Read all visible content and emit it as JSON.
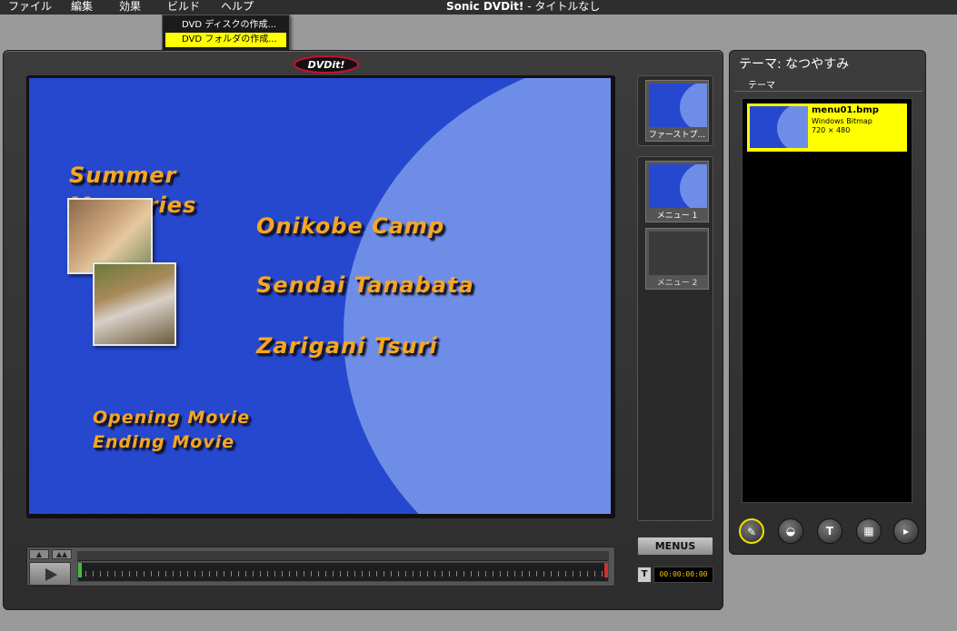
{
  "menubar": {
    "items": [
      "ファイル",
      "編集",
      "効果",
      "ビルド",
      "ヘルプ"
    ],
    "app_title": "Sonic DVDit!",
    "doc_title": " - タイトルなし"
  },
  "build_menu": {
    "items": [
      "DVD ディスクの作成...",
      "DVD フォルダの作成..."
    ],
    "highlighted_index": 1
  },
  "main": {
    "logo_text": "DVDit!",
    "menu_preview": {
      "title_line1": "Summer",
      "title_line2": "Memories",
      "link1": "Onikobe Camp",
      "link2": "Sendai Tanabata",
      "link3": "Zarigani Tsuri",
      "link4": "Opening Movie",
      "link5": "Ending Movie"
    },
    "thumbnails": {
      "first_play_label": "ファーストプ...",
      "menu1_label": "メニュー 1",
      "menu2_label": "メニュー 2"
    },
    "timeline": {
      "small_btn1": "▲",
      "small_btn2": "▲▲"
    },
    "menus_button": "MENUS",
    "t_button": "T",
    "timecode": "00:00:00:00"
  },
  "theme_panel": {
    "title": "テーマ: なつやすみ",
    "tab": "テーマ",
    "item": {
      "name": "menu01.bmp",
      "type": "Windows Bitmap",
      "dims": "720 × 480"
    },
    "tool_icons": [
      "backgrounds-icon",
      "buttons-icon",
      "text-icon",
      "media-icon",
      "next-icon"
    ]
  },
  "colors": {
    "accent_yellow": "#ffff00",
    "menu_text_orange": "#f5a623",
    "preview_blue": "#2648cf",
    "preview_light_blue": "#6e8de6"
  }
}
